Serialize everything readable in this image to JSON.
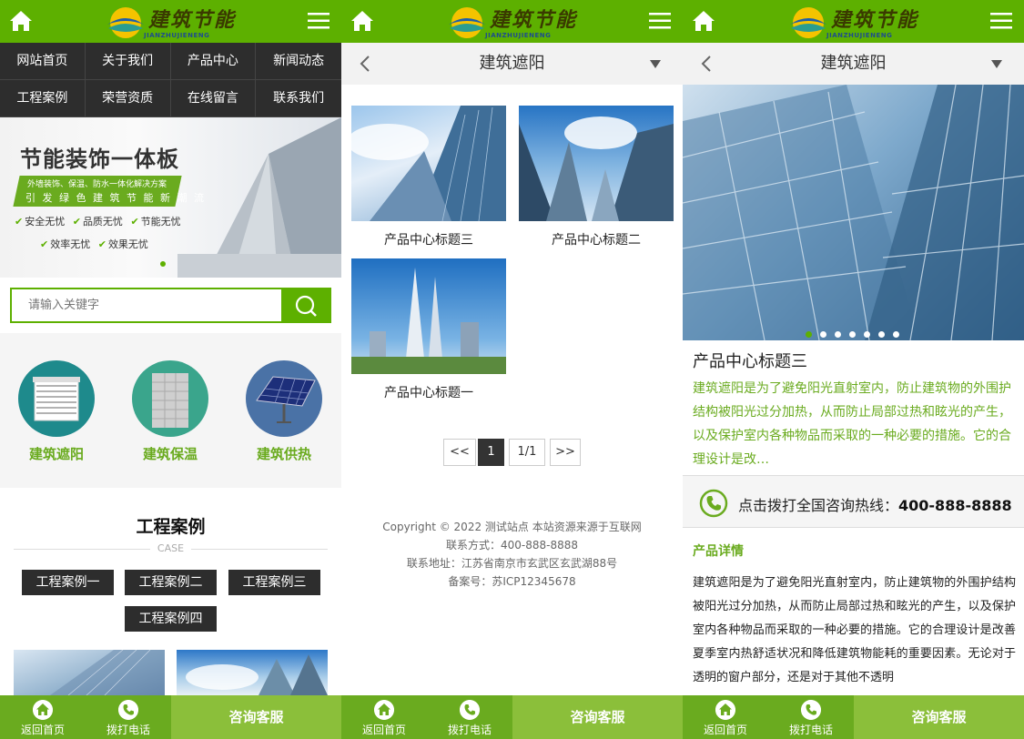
{
  "brand": {
    "logo_text": "建筑节能",
    "logo_sub": "JIANZHUJIENENG",
    "green": "#5db000",
    "dark": "#2d2d2d",
    "light_green": "#8bbf3a"
  },
  "home": {
    "nav": [
      "网站首页",
      "关于我们",
      "产品中心",
      "新闻动态",
      "工程案例",
      "荣营资质",
      "在线留言",
      "联系我们"
    ],
    "banner": {
      "title": "节能装饰一体板",
      "sub1": "外墙装饰、保温、防水一体化解决方案",
      "sub2": "引 发 绿 色 建 筑 节 能 新 潮 流",
      "checks_row1": [
        "安全无忧",
        "品质无忧",
        "节能无忧"
      ],
      "checks_row2": [
        "效率无忧",
        "效果无忧"
      ]
    },
    "search_placeholder": "请输入关键字",
    "categories": [
      "建筑遮阳",
      "建筑保温",
      "建筑供热"
    ],
    "section_title": "工程案例",
    "section_sub": "CASE",
    "case_buttons": [
      "工程案例一",
      "工程案例二",
      "工程案例三",
      "工程案例四"
    ]
  },
  "bottom_bar": {
    "home": "返回首页",
    "call": "拨打电话",
    "consult": "咨询客服"
  },
  "list": {
    "title": "建筑遮阳",
    "products": [
      "产品中心标题三",
      "产品中心标题二",
      "产品中心标题一"
    ],
    "pager": {
      "prev": "<<",
      "page": "1",
      "total": "1/1",
      "next": ">>"
    },
    "footer": {
      "copyright": "Copyright © 2022 测试站点 本站资源来源于互联网",
      "phone": "联系方式：400-888-8888",
      "address": "联系地址：江苏省南京市玄武区玄武湖88号",
      "icp": "备案号：苏ICP12345678"
    }
  },
  "detail": {
    "title": "建筑遮阳",
    "product_title": "产品中心标题三",
    "summary": "建筑遮阳是为了避免阳光直射室内，防止建筑物的外围护结构被阳光过分加热，从而防止局部过热和眩光的产生，以及保护室内各种物品而采取的一种必要的措施。它的合理设计是改…",
    "hotline_label": "点击拨打全国咨询热线：",
    "hotline_number": "400-888-8888",
    "detail_heading": "产品详情",
    "detail_body": "建筑遮阳是为了避免阳光直射室内，防止建筑物的外围护结构被阳光过分加热，从而防止局部过热和眩光的产生，以及保护室内各种物品而采取的一种必要的措施。它的合理设计是改善夏季室内热舒适状况和降低建筑物能耗的重要因素。无论对于透明的窗户部分，还是对于其他不透明"
  }
}
